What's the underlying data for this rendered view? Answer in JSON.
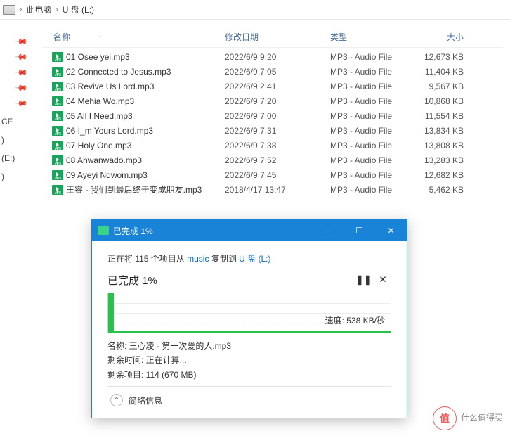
{
  "breadcrumb": {
    "loc1": "此电脑",
    "loc2": "U 盘 (L:)"
  },
  "left": {
    "l1": "CF",
    "l2": ")",
    "l3": "(E:)",
    "l4": ")"
  },
  "columns": {
    "name": "名称",
    "date": "修改日期",
    "type": "类型",
    "size": "大小"
  },
  "files": [
    {
      "name": "01 Osee yei.mp3",
      "date": "2022/6/9 9:20",
      "type": "MP3 - Audio File",
      "size": "12,673 KB"
    },
    {
      "name": "02 Connected to Jesus.mp3",
      "date": "2022/6/9 7:05",
      "type": "MP3 - Audio File",
      "size": "11,404 KB"
    },
    {
      "name": "03 Revive Us Lord.mp3",
      "date": "2022/6/9 2:41",
      "type": "MP3 - Audio File",
      "size": "9,567 KB"
    },
    {
      "name": "04 Mehia Wo.mp3",
      "date": "2022/6/9 7:20",
      "type": "MP3 - Audio File",
      "size": "10,868 KB"
    },
    {
      "name": "05 All I Need.mp3",
      "date": "2022/6/9 7:00",
      "type": "MP3 - Audio File",
      "size": "11,554 KB"
    },
    {
      "name": "06 I_m Yours Lord.mp3",
      "date": "2022/6/9 7:31",
      "type": "MP3 - Audio File",
      "size": "13,834 KB"
    },
    {
      "name": "07 Holy One.mp3",
      "date": "2022/6/9 7:38",
      "type": "MP3 - Audio File",
      "size": "13,808 KB"
    },
    {
      "name": "08 Anwanwado.mp3",
      "date": "2022/6/9 7:52",
      "type": "MP3 - Audio File",
      "size": "13,283 KB"
    },
    {
      "name": "09 Ayeyi Ndwom.mp3",
      "date": "2022/6/9 7:45",
      "type": "MP3 - Audio File",
      "size": "12,682 KB"
    },
    {
      "name": "王睿 - 我们到最后终于变成朋友.mp3",
      "date": "2018/4/17 13:47",
      "type": "MP3 - Audio File",
      "size": "5,462 KB"
    }
  ],
  "dialog": {
    "title": "已完成 1%",
    "line1_pre": "正在将 115 个项目从 ",
    "line1_src": "music",
    "line1_mid": " 复制到 ",
    "line1_dst": "U 盘 (L:)",
    "line2": "已完成 1%",
    "speed": "速度: 538 KB/秒",
    "name_label": "名称: ",
    "name_value": "王心凌 - 第一次爱的人.mp3",
    "time_label": "剩余时间: ",
    "time_value": "正在计算...",
    "items_label": "剩余项目: ",
    "items_value": "114 (670 MB)",
    "footer": "简略信息"
  },
  "watermark": {
    "char": "值",
    "text": "什么值得买"
  }
}
